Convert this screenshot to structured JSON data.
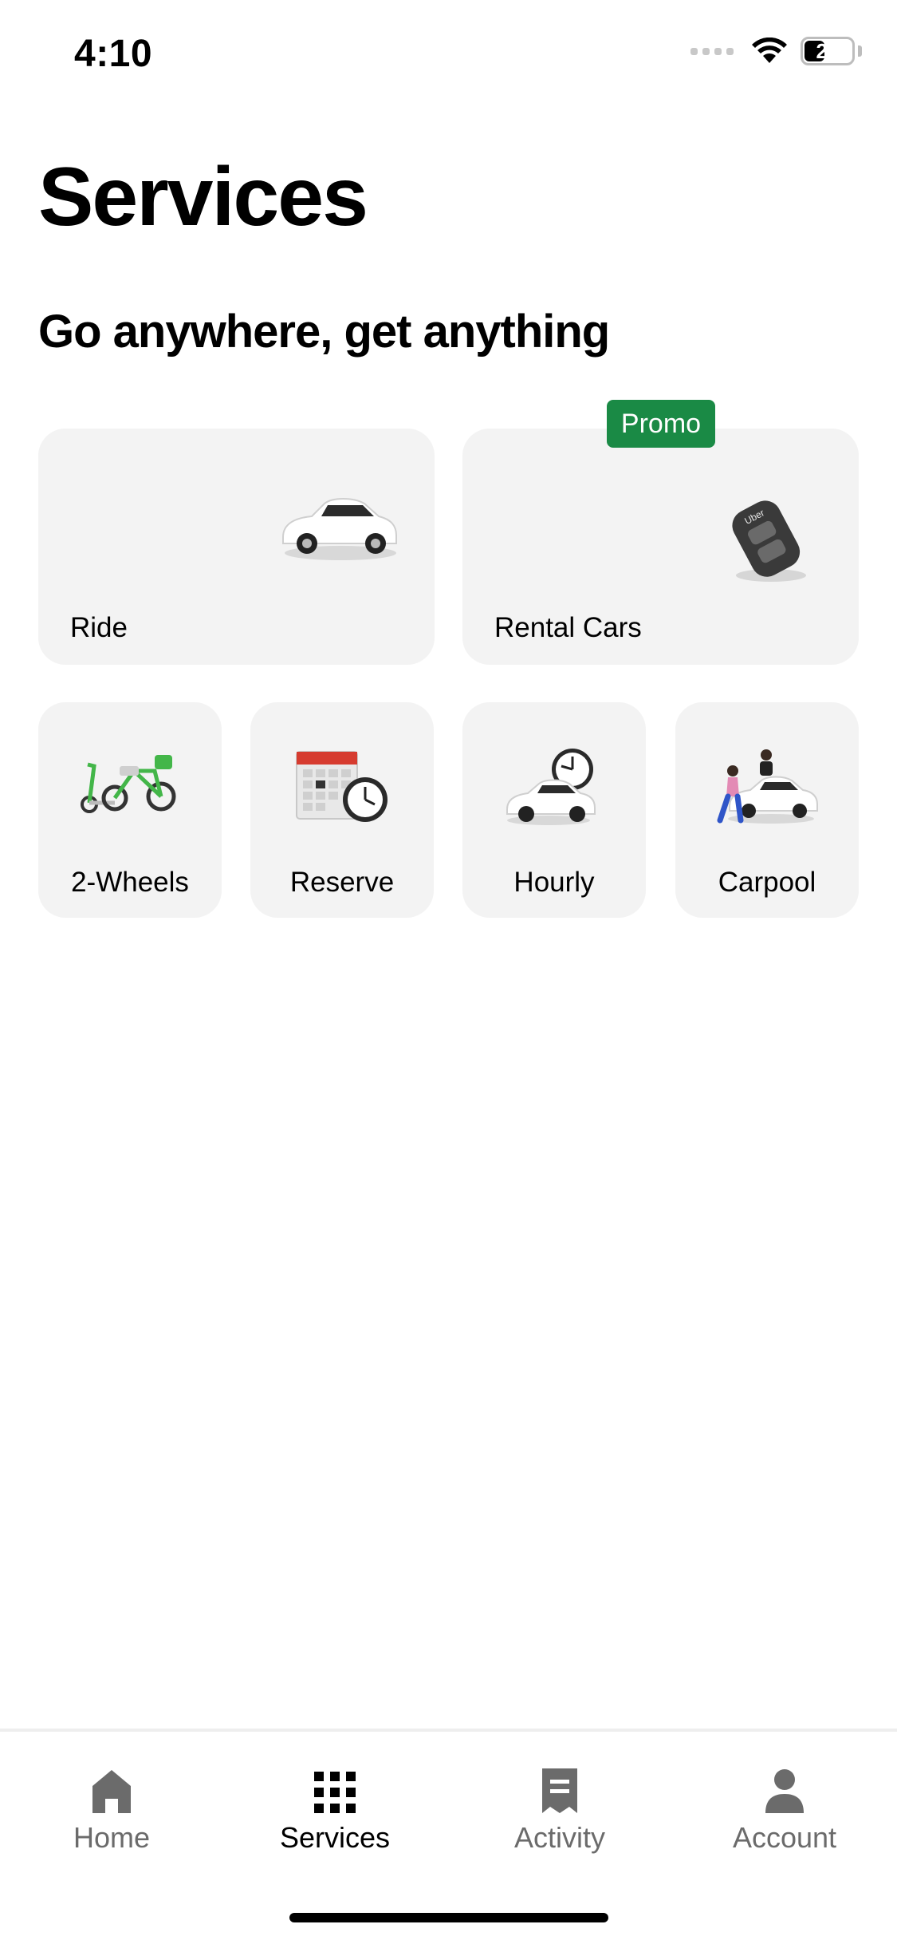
{
  "status_bar": {
    "time": "4:10",
    "battery_level": "25",
    "icons": [
      "cellular-signal-icon",
      "wifi-icon",
      "battery-icon"
    ]
  },
  "page": {
    "title": "Services",
    "subtitle": "Go anywhere, get anything"
  },
  "services_large": [
    {
      "label": "Ride",
      "icon": "car-icon"
    },
    {
      "label": "Rental Cars",
      "icon": "car-key-icon",
      "badge": "Promo"
    }
  ],
  "services_small": [
    {
      "label": "2-Wheels",
      "icon": "scooter-bike-icon"
    },
    {
      "label": "Reserve",
      "icon": "calendar-clock-icon"
    },
    {
      "label": "Hourly",
      "icon": "car-clock-icon"
    },
    {
      "label": "Carpool",
      "icon": "carpool-icon"
    }
  ],
  "tab_bar": {
    "active": "Services",
    "tabs": [
      {
        "label": "Home",
        "icon": "home-icon"
      },
      {
        "label": "Services",
        "icon": "grid-icon"
      },
      {
        "label": "Activity",
        "icon": "receipt-icon"
      },
      {
        "label": "Account",
        "icon": "person-icon"
      }
    ]
  },
  "colors": {
    "promo_badge": "#1a8a45",
    "tile_background": "#f3f3f3",
    "inactive_tab": "#6b6b6b"
  }
}
